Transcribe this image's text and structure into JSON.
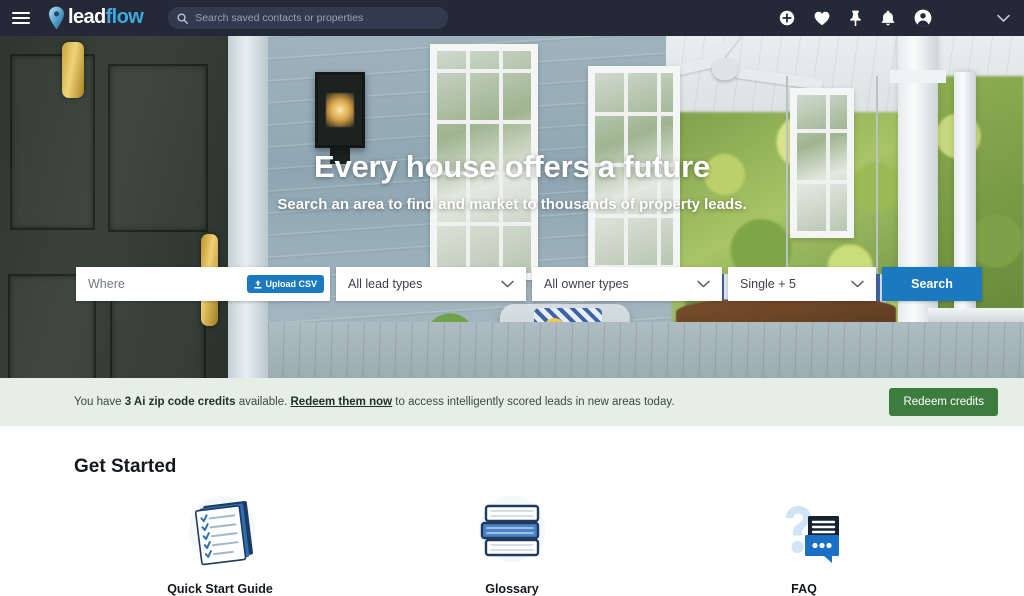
{
  "header": {
    "menu_icon": "hamburger-menu-icon",
    "logo": {
      "lead": "lead",
      "flow": "flow",
      "pin_icon": "map-pin-icon"
    },
    "search": {
      "icon": "search-icon",
      "placeholder": "Search saved contacts or properties",
      "value": ""
    },
    "icons": [
      {
        "name": "add-circle-icon",
        "label": "Add"
      },
      {
        "name": "heart-icon",
        "label": "Favorites"
      },
      {
        "name": "pin-icon",
        "label": "Pinned"
      },
      {
        "name": "bell-icon",
        "label": "Notifications"
      },
      {
        "name": "user-account-icon",
        "label": "Account"
      }
    ],
    "chevron_icon": "chevron-down-icon",
    "bg_color": "#242938",
    "accent_color": "#3fa9dc"
  },
  "hero": {
    "title": "Every house offers a future",
    "subtitle": "Search an area to find and market to thousands of property leads.",
    "search_form": {
      "where": {
        "placeholder": "Where",
        "value": ""
      },
      "upload_csv": {
        "label": "Upload CSV",
        "icon": "upload-icon"
      },
      "lead_types": {
        "value": "All lead types",
        "icon": "chevron-down-icon"
      },
      "owner_types": {
        "value": "All owner types",
        "icon": "chevron-down-icon"
      },
      "property_type": {
        "value": "Single + 5",
        "icon": "chevron-down-icon"
      },
      "search_button": {
        "label": "Search",
        "color": "#1b79bf"
      }
    }
  },
  "banner": {
    "text_before": "You have ",
    "credits": "3 Ai zip code credits",
    "text_middle": " available. ",
    "link": "Redeem them now",
    "text_after": " to access intelligently scored leads in new areas today.",
    "button": {
      "label": "Redeem credits",
      "color": "#3c7d3f"
    },
    "bg_color": "#e6efe6"
  },
  "get_started": {
    "title": "Get Started",
    "cards": [
      {
        "label": "Quick Start Guide",
        "icon": "checklist-document-icon"
      },
      {
        "label": "Glossary",
        "icon": "stacked-books-icon"
      },
      {
        "label": "FAQ",
        "icon": "question-chat-bubbles-icon"
      }
    ]
  }
}
